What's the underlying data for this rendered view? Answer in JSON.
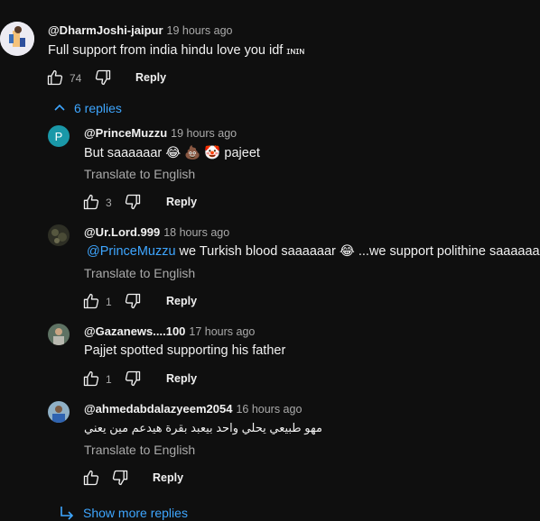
{
  "top_comment": {
    "handle": "@DharmJoshi-jaipur",
    "time": "19 hours ago",
    "text": "Full support from india hindu love you idf",
    "text_suffix": "ɪɴɪɴ",
    "likes": "74",
    "reply_label": "Reply"
  },
  "replies_toggle": "6 replies",
  "replies": [
    {
      "handle": "@PrinceMuzzu",
      "time": "19 hours ago",
      "avatar_letter": "P",
      "text": "But saaaaaar 😂 💩 🤡 pajeet",
      "translate": "Translate to English",
      "likes": "3",
      "reply_label": "Reply"
    },
    {
      "handle": "@Ur.Lord.999",
      "time": "18 hours ago",
      "mention": "@PrinceMuzzu",
      "text": " we Turkish blood saaaaaar 😂 ...we support polithine saaaaaar",
      "translate": "Translate to English",
      "likes": "1",
      "reply_label": "Reply"
    },
    {
      "handle": "@Gazanews....100",
      "time": "17 hours ago",
      "text": "Pajjet spotted supporting his father",
      "likes": "1",
      "reply_label": "Reply"
    },
    {
      "handle": "@ahmedabdalazyeem2054",
      "time": "16 hours ago",
      "text": "مهو طبيعي يحلي واحد بيعبد بقرة هيدعم مين يعني",
      "translate": "Translate to English",
      "likes": "",
      "reply_label": "Reply"
    }
  ],
  "show_more": "Show more replies",
  "colors": {
    "background": "#0f0f0f",
    "link": "#3ea6ff",
    "muted": "#aaaaaa",
    "avatar_p": "#1a98a8"
  },
  "icons": [
    "thumbs-up-icon",
    "thumbs-down-icon",
    "chevron-up-icon",
    "reply-arrow-icon"
  ]
}
